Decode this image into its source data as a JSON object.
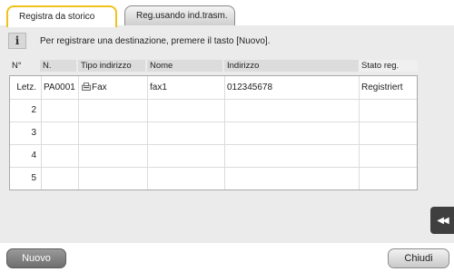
{
  "tabs": {
    "active": "Registra da storico",
    "inactive": "Reg.usando ind.trasm."
  },
  "info": {
    "icon": "info-icon",
    "text": "Per registrare una destinazione, premere il tasto [Nuovo]."
  },
  "table": {
    "headers": [
      "N°",
      "N.",
      "Tipo indirizzo",
      "Nome",
      "Indirizzo",
      "Stato reg."
    ],
    "rows": [
      {
        "index": "Letz.",
        "n": "PA0001",
        "type": "Fax",
        "name": "fax1",
        "address": "012345678",
        "status": "Registriert"
      },
      {
        "index": "2",
        "n": "",
        "type": "",
        "name": "",
        "address": "",
        "status": ""
      },
      {
        "index": "3",
        "n": "",
        "type": "",
        "name": "",
        "address": "",
        "status": ""
      },
      {
        "index": "4",
        "n": "",
        "type": "",
        "name": "",
        "address": "",
        "status": ""
      },
      {
        "index": "5",
        "n": "",
        "type": "",
        "name": "",
        "address": "",
        "status": ""
      }
    ]
  },
  "side_button": {
    "label": "◀◀",
    "icon": "double-left-arrow-icon"
  },
  "buttons": {
    "new": "Nuovo",
    "close": "Chiudi"
  },
  "colors": {
    "active_tab_border": "#f1c21b",
    "panel": "#ebebeb"
  }
}
